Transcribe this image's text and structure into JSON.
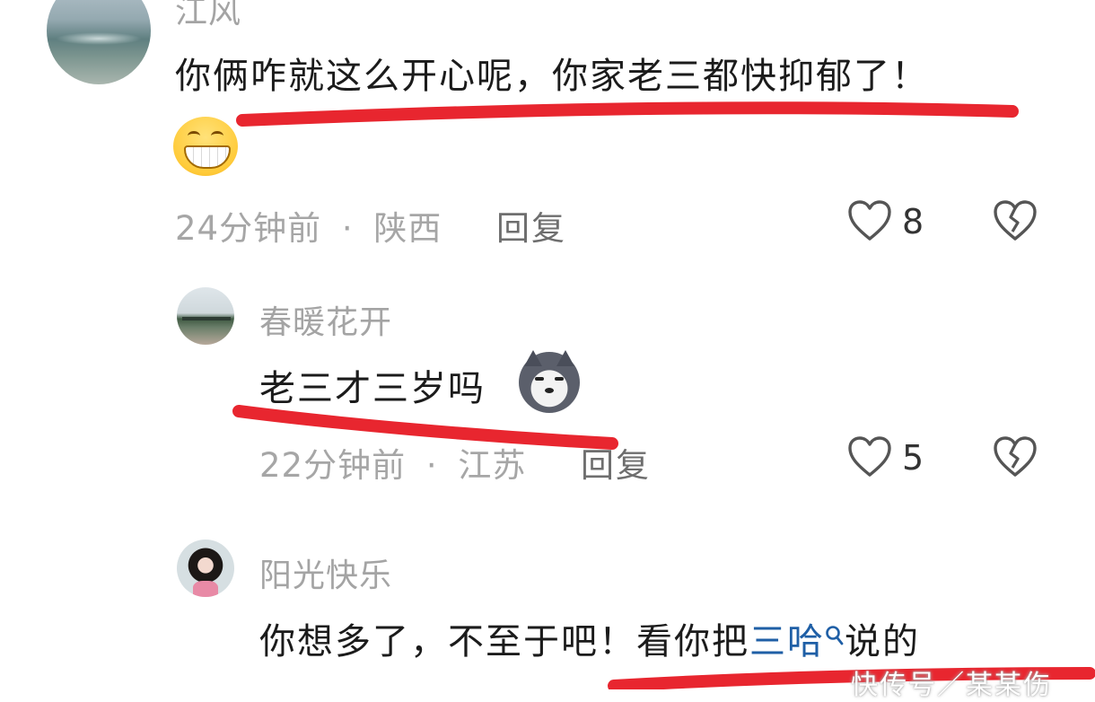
{
  "comments": [
    {
      "username": "江风",
      "text": "你俩咋就这么开心呢，你家老三都快抑郁了！",
      "emoji": "grinning-face",
      "time": "24分钟前",
      "separator": "·",
      "location": "陕西",
      "reply_label": "回复",
      "likes": "8"
    },
    {
      "username": "春暖花开",
      "text": "老三才三岁吗",
      "emoji": "doge",
      "time": "22分钟前",
      "separator": "·",
      "location": "江苏",
      "reply_label": "回复",
      "likes": "5"
    },
    {
      "username": "阳光快乐",
      "text_before": "你想多了，不至于吧！看你把",
      "link_text": "三哈",
      "text_after": "说的"
    }
  ],
  "watermark": "快传号／某某伤",
  "colors": {
    "underline": "#e8262f",
    "link": "#1f5fa6",
    "meta": "#a6a6a6"
  },
  "icons": [
    "heart-outline-icon",
    "broken-heart-icon",
    "search-icon"
  ]
}
